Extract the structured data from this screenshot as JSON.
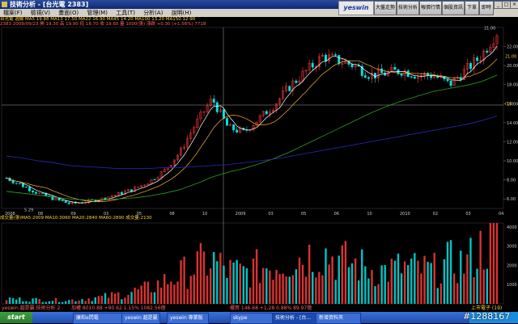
{
  "window": {
    "title": "技術分析 - [台光電 2383]"
  },
  "menu": [
    "檔案(F)",
    "檢視(V)",
    "畫面(O)",
    "管理(M)",
    "工具(T)",
    "分析(A)",
    "說明(H)"
  ],
  "toolbar": {
    "logo": "yeswin",
    "buttons": [
      "大盤走勢圖",
      "技術分析",
      "報價行情",
      "個股資訊",
      "下單",
      "即時新聞"
    ]
  },
  "price_info": {
    "line1": "台光電 週線 MA5 19.88 MA13 17.50 MA22 16.90 MA45 14.20 MA100 13.20 MA150 12.90",
    "line2": "2383 2009/09/23 開 19.30 高 19.90 低 18.70 收 19.60 量 1000(張) 漲跌 +0.30 (+1.56%) 7718"
  },
  "volume_info": "成交量(張)MA5:2009 MA10:3060 MA20:2840 MA60:2890 成交量:2130",
  "price_axis": [
    "22.00",
    "20.00",
    "18.00",
    "16.00",
    "14.00",
    "12.00",
    "10.00",
    "8.00",
    "6.00"
  ],
  "price_tags": [
    "21.00",
    "(19)"
  ],
  "volume_axis": [
    "4000",
    "3000",
    "2000",
    "1000"
  ],
  "time_axis": [
    "2008",
    "08",
    "09",
    "03",
    "05",
    "08",
    "10",
    "2009",
    "03",
    "05",
    "06",
    "10",
    "2010",
    "02",
    "03",
    "04"
  ],
  "top_label": "21.00",
  "low_label": "5.29",
  "status": {
    "left": "yeswin 越是贏 技術分析 2",
    "middle": "加權 8010.88 +90.62 1.15% 1082.56億",
    "right": "櫃買 146.68 +1.28 0.88% 89.97億",
    "far": "上市電子 (19)"
  },
  "taskbar": {
    "start": "start",
    "tasks": [
      "康和e閃電",
      "yeswin 越是贏",
      "yeswin 專業版",
      "skype",
      "技術分析 - [台...",
      "新增資料夾"
    ]
  },
  "watermark": "#1288167",
  "colors": {
    "up": "#ff3b3b",
    "down": "#00e5e5",
    "ma5": "#ffffff",
    "ma22": "#ffb030",
    "ma45": "#2ea020",
    "ma150": "#2828c0",
    "grid": "#555555"
  },
  "chart_data": {
    "type": "candlestick",
    "x": [
      "2008",
      "08",
      "09",
      "03",
      "05",
      "08",
      "10",
      "2009",
      "03",
      "05",
      "06",
      "10",
      "2010",
      "02",
      "03",
      "04"
    ],
    "close": [
      8.2,
      7.4,
      6.6,
      6.0,
      5.5,
      5.7,
      6.0,
      6.5,
      7.0,
      7.8,
      9.0,
      11.0,
      14.0,
      16.5,
      13.5,
      13.0,
      14.5,
      16.0,
      18.0,
      19.5,
      21.0,
      20.5,
      20.0,
      19.0,
      19.2,
      19.5,
      19.0,
      19.0,
      18.0,
      19.5,
      21.0,
      23.5
    ],
    "ma_long": [
      6.8,
      6.6,
      6.4,
      6.2,
      6.0,
      5.9,
      5.9,
      6.0,
      6.1,
      6.3,
      6.6,
      7.0,
      7.6,
      8.3,
      8.8,
      9.2,
      9.7,
      10.3,
      11.0,
      11.8,
      12.6,
      13.4,
      14.2,
      15.0,
      15.7,
      16.3,
      16.8,
      17.3,
      17.6,
      17.9,
      18.3,
      19.0
    ],
    "ma_very_long": [
      10.5,
      10.3,
      10.0,
      9.8,
      9.5,
      9.4,
      9.3,
      9.2,
      9.2,
      9.2,
      9.3,
      9.3,
      9.4,
      9.5,
      9.6,
      9.8,
      10.0,
      10.2,
      10.5,
      10.8,
      11.1,
      11.4,
      11.7,
      12.0,
      12.3,
      12.6,
      12.9,
      13.2,
      13.5,
      13.8,
      14.2,
      14.7
    ],
    "volume": [
      300,
      260,
      240,
      220,
      210,
      300,
      380,
      520,
      700,
      900,
      1300,
      1700,
      2200,
      2500,
      1900,
      1800,
      2100,
      2300,
      2600,
      2800,
      3000,
      2500,
      2300,
      2000,
      1900,
      2100,
      2000,
      1900,
      2400,
      2300,
      3200,
      4000
    ],
    "ylim": [
      5,
      24
    ],
    "vol_ylim": [
      0,
      4200
    ]
  }
}
